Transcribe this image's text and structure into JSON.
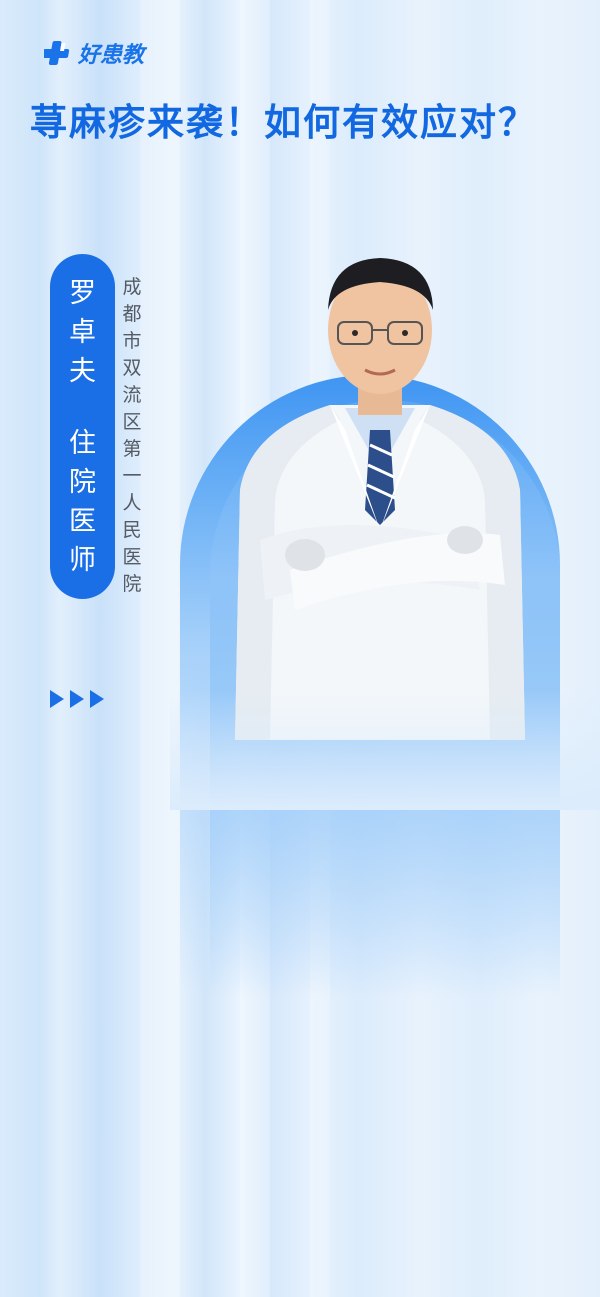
{
  "brand": {
    "name": "好患教"
  },
  "title": "荨麻疹来袭！如何有效应对？",
  "doctor": {
    "name": "罗卓夫",
    "role": "住院医师",
    "hospital": "成都市双流区第一人民医院"
  },
  "icons": [
    "logo-cross-icon",
    "arrow-right-icon"
  ],
  "colors": {
    "brand_blue": "#1b6fe6",
    "title_blue": "#1268e0"
  }
}
